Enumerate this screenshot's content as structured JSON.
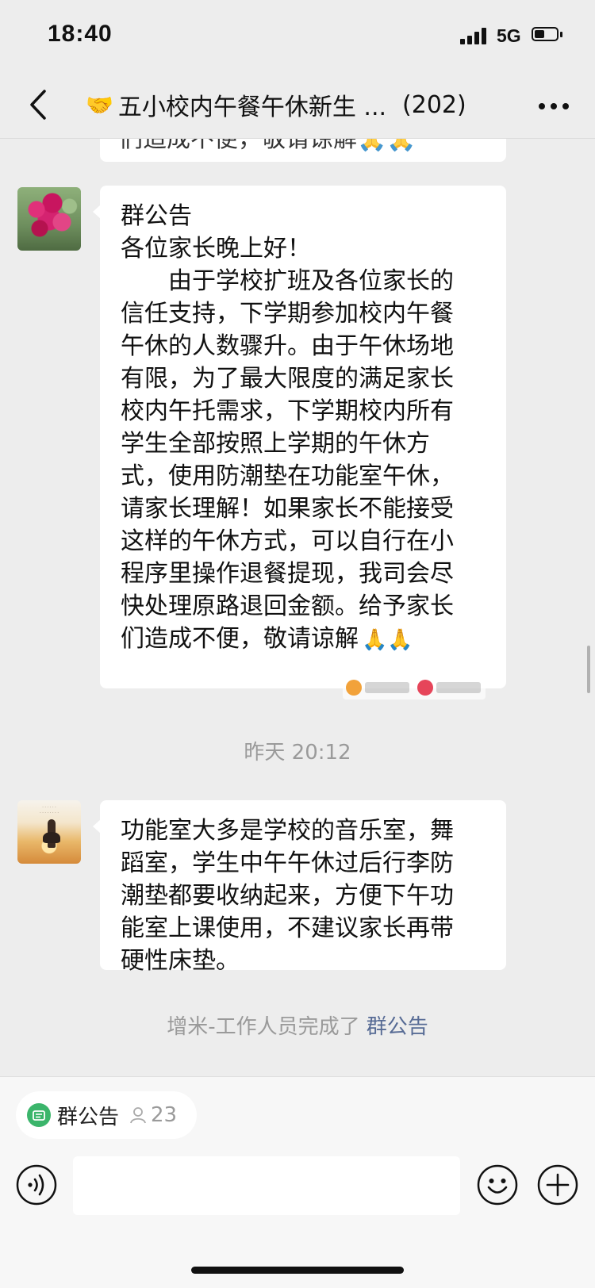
{
  "status_bar": {
    "time": "18:40",
    "network": "5G",
    "battery_level": 0.45,
    "signal_icon": "cellular-signal-icon",
    "battery_icon": "battery-icon"
  },
  "nav": {
    "back_icon": "chevron-left-icon",
    "title_emoji": "🤝",
    "title": "五小校内午餐午休新生 ...",
    "member_count": "(202)",
    "more_icon": "more-dots-icon"
  },
  "messages": {
    "previous_fragment": "们造成不便，敬请谅解🙏🙏",
    "notice": {
      "lines": [
        "群公告",
        "各位家长晚上好！",
        "由于学校扩班及各位家长的",
        "信任支持，下学期参加校内午餐",
        "午休的人数骤升。由于午休场地",
        "有限，为了最大限度的满足家长",
        "校内午托需求，下学期校内所有",
        "学生全部按照上学期的午休方",
        "式，使用防潮垫在功能室午休，",
        "请家长理解！如果家长不能接受",
        "这样的午休方式，可以自行在小",
        "程序里操作退餐提现，我司会尽",
        "快处理原路退回金额。给予家长",
        "们造成不便，敬请谅解"
      ],
      "emoji": "🙏🙏"
    },
    "timestamp": "昨天 20:12",
    "reply": {
      "lines": [
        "功能室大多是学校的音乐室，舞",
        "蹈室，学生中午午休过后行李防",
        "潮垫都要收纳起来，方便下午功",
        "能室上课使用，不建议家长再带",
        "硬性床垫。"
      ]
    },
    "system": {
      "text": "增米-工作人员完成了",
      "link": "群公告"
    }
  },
  "pinned": {
    "label": "群公告",
    "count": "23",
    "icon": "announcement-icon",
    "reader_icon": "person-icon"
  },
  "input_bar": {
    "value": "",
    "voice_icon": "voice-icon",
    "emoji_icon": "emoji-icon",
    "plus_icon": "plus-icon"
  },
  "colors": {
    "background": "#ededed",
    "bubble": "#ffffff",
    "link": "#576b95",
    "meta_text": "#9a9a9a",
    "announcement_green": "#3bb56b"
  }
}
